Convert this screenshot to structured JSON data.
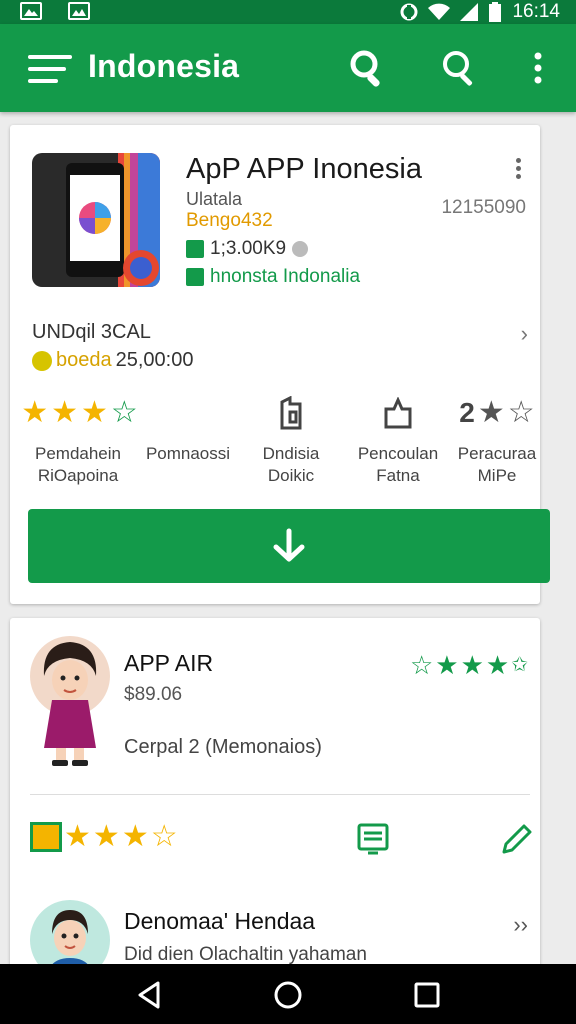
{
  "status": {
    "time": "16:14"
  },
  "appbar": {
    "title": "Indonesia",
    "menu_icon": "menu-icon",
    "actions": [
      "search-icon",
      "search-icon",
      "more-vert-icon"
    ]
  },
  "app": {
    "title": "ApP APP Inonesia",
    "developer": "Ulatala",
    "category": "Bengo432",
    "size": "1;3.00K9",
    "language": "hnonsta Indonalia",
    "id": "12155090",
    "info_label": "UNDqil 3CAL",
    "price_prefix": "boeda",
    "price": "25,00:00"
  },
  "stats": [
    {
      "label": "Pemdahein\nRiOapoina",
      "icon": "rating-stars"
    },
    {
      "label": "Pomnaossi",
      "icon": ""
    },
    {
      "label": "Dndisia\nDoikic",
      "icon": "bookmark-icon"
    },
    {
      "label": "Pencoulan\nFatna",
      "icon": "badge-icon"
    },
    {
      "label": "Peracuraa\nMiPe",
      "icon": "star-rating-icon"
    }
  ],
  "stat_rating": "2",
  "install": {
    "icon": "download-icon"
  },
  "review": {
    "name": "APP AIR",
    "price": "$89.06",
    "subtitle": "Cerpal 2 (Memonaios)",
    "stars": 4
  },
  "developer": {
    "name": "Denomaa' Hendaa",
    "subtitle": "Did dien Olachaltin yahaman"
  },
  "colors": {
    "primary": "#139a4a",
    "status_bar": "#0b7a3b",
    "star": "#f4b400"
  }
}
